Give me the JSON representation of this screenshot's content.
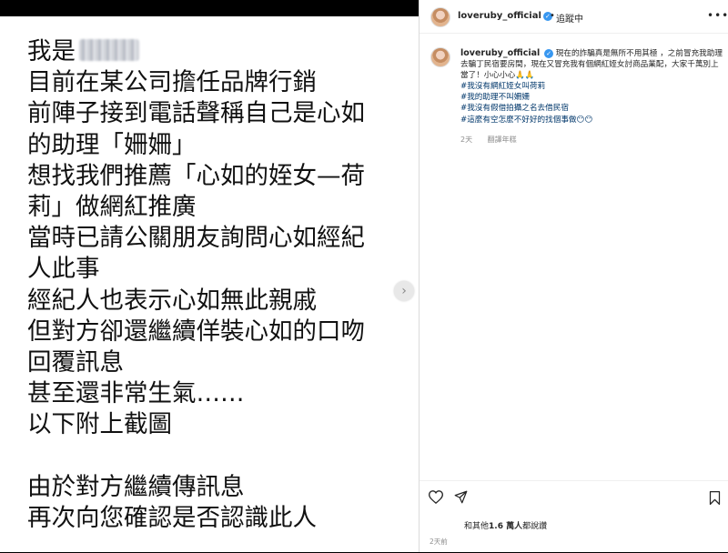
{
  "media": {
    "lines": [
      "我是",
      "目前在某公司擔任品牌行銷",
      "前陣子接到電話聲稱自己是心如",
      "的助理「姍姍」",
      "想找我們推薦「心如的姪女—荷",
      "莉」做網紅推廣",
      "當時已請公關朋友詢問心如經紀",
      "人此事",
      "經紀人也表示心如無此親戚",
      "但對方卻還繼續佯裝心如的口吻",
      "回覆訊息",
      "甚至還非常生氣……",
      "以下附上截圖",
      "",
      "由於對方繼續傳訊息",
      "再次向您確認是否認識此人"
    ]
  },
  "post": {
    "username": "loveruby_official",
    "follow_separator": "•",
    "follow_status": "追蹤中",
    "more_label": "•••",
    "caption_text": "現在的詐騙真是無所不用其極 ，之前冒充我助理去騙丁民宿要房間，現在又冒充我有個網紅姪女討商品業配，大家千萬別上當了！小心小心🙏🙏",
    "hashtags": [
      "#我沒有網紅姪女叫荷莉",
      "#我的助理不叫姍姍",
      "#我沒有假借拍攝之名去借民宿",
      "#這麼有空怎麼不好好的找個事做😶😶"
    ],
    "comment_time": "2天",
    "translate_label": "翻譯年糕",
    "likes_prefix": "和其他",
    "likes_count": "1.6 萬人",
    "likes_suffix": "都說讚",
    "date": "2天前"
  },
  "colors": {
    "verified": "#3897f0",
    "hashtag": "#00376b",
    "muted": "#8e8e8e"
  }
}
